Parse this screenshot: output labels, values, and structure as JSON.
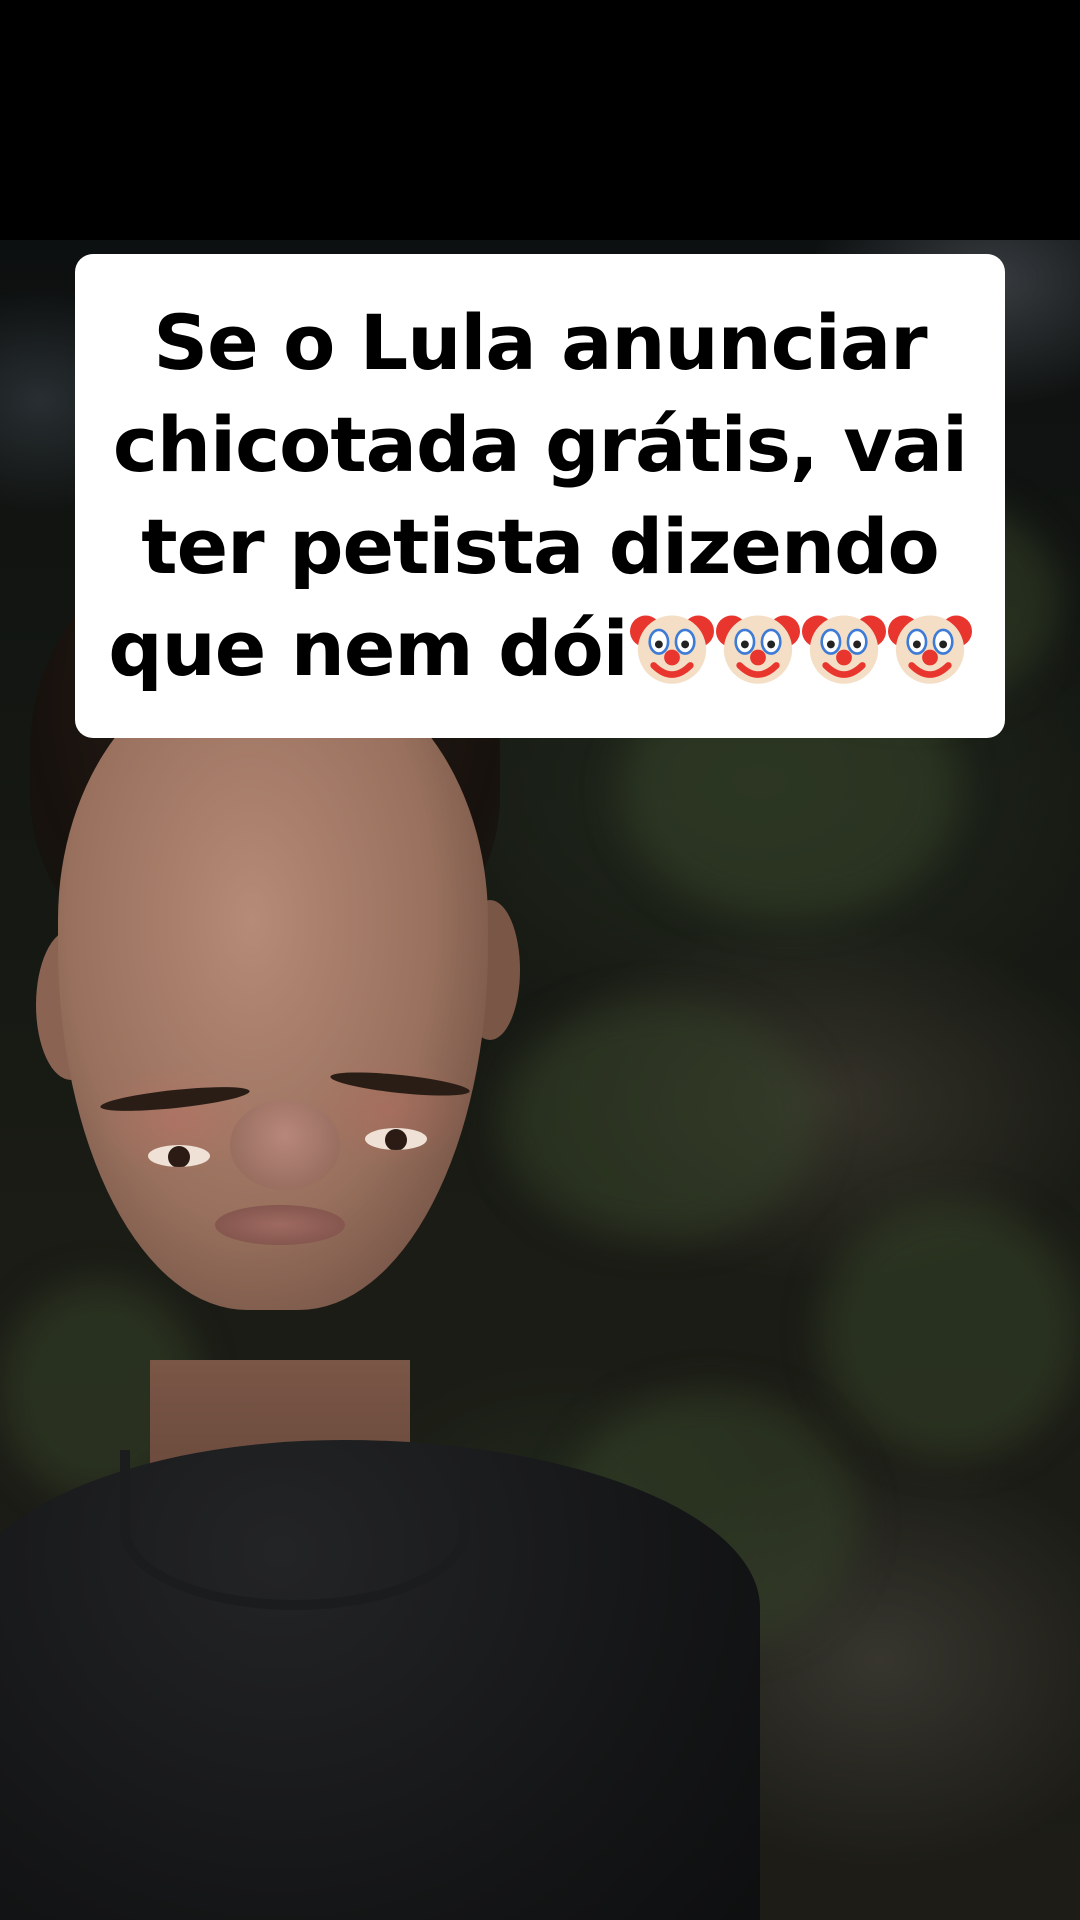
{
  "caption": {
    "lines": [
      "Se o Lula anunciar",
      "chicotada grátis, vai",
      "ter petista dizendo",
      "que nem dói"
    ],
    "emoji": [
      "clown-icon",
      "clown-icon",
      "clown-icon",
      "clown-icon"
    ],
    "background": "#ffffff",
    "text_color": "#000000"
  }
}
